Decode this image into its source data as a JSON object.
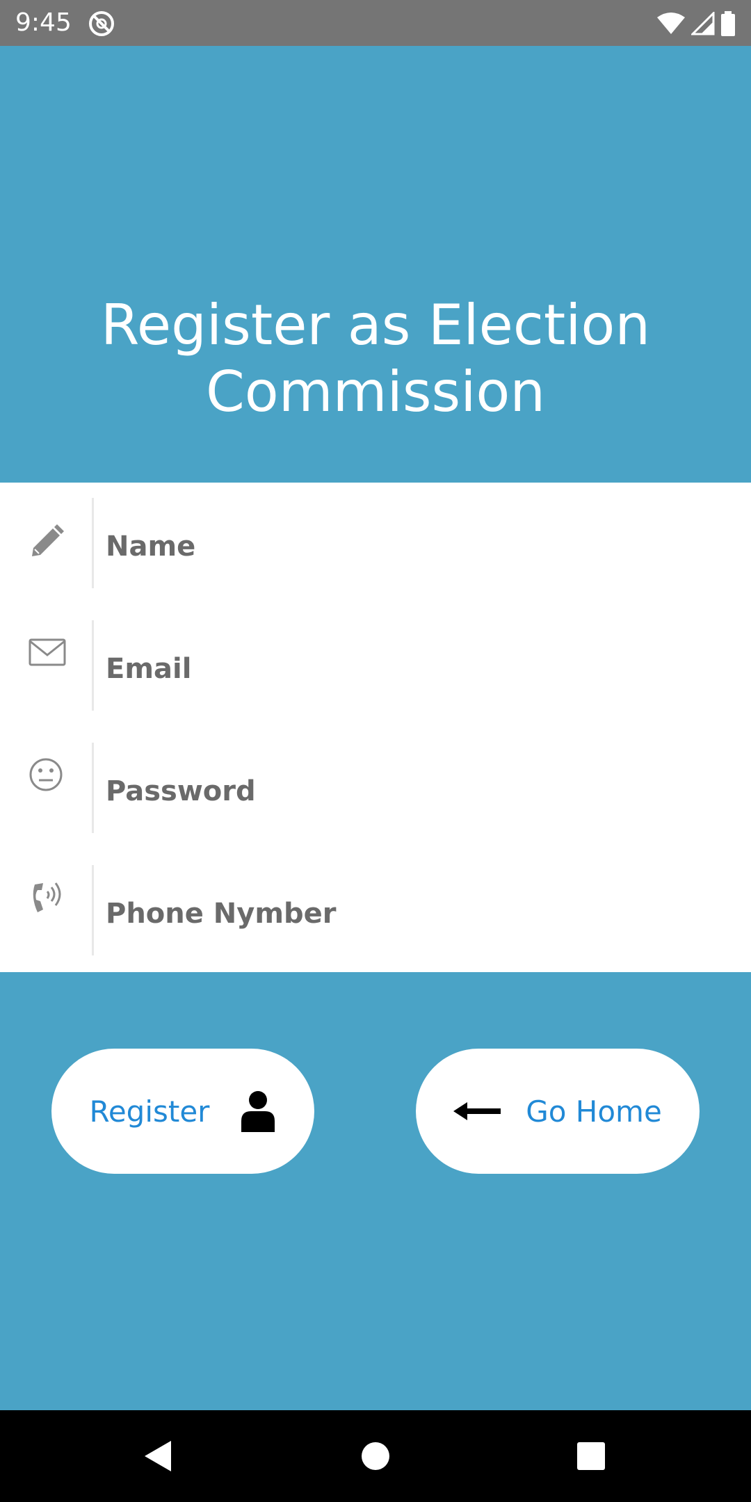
{
  "status_bar": {
    "time": "9:45",
    "icons": [
      "app-sync-icon",
      "wifi-icon",
      "cell-signal-icon",
      "battery-icon"
    ]
  },
  "header": {
    "title": "Register as Election Commission",
    "background": "#4aa3c6"
  },
  "form": {
    "fields": [
      {
        "icon": "pencil-icon",
        "placeholder": "Name",
        "value": ""
      },
      {
        "icon": "envelope-icon",
        "placeholder": "Email",
        "value": ""
      },
      {
        "icon": "neutral-face-icon",
        "placeholder": "Password",
        "value": ""
      },
      {
        "icon": "phone-icon",
        "placeholder": "Phone Nymber",
        "value": ""
      }
    ]
  },
  "actions": {
    "register_label": "Register",
    "register_icon": "user-icon",
    "home_label": "Go Home",
    "home_icon": "arrow-left-icon",
    "label_color": "#2189d6"
  },
  "nav_bar": {
    "buttons": [
      "back-icon",
      "home-circle-icon",
      "recents-square-icon"
    ]
  }
}
